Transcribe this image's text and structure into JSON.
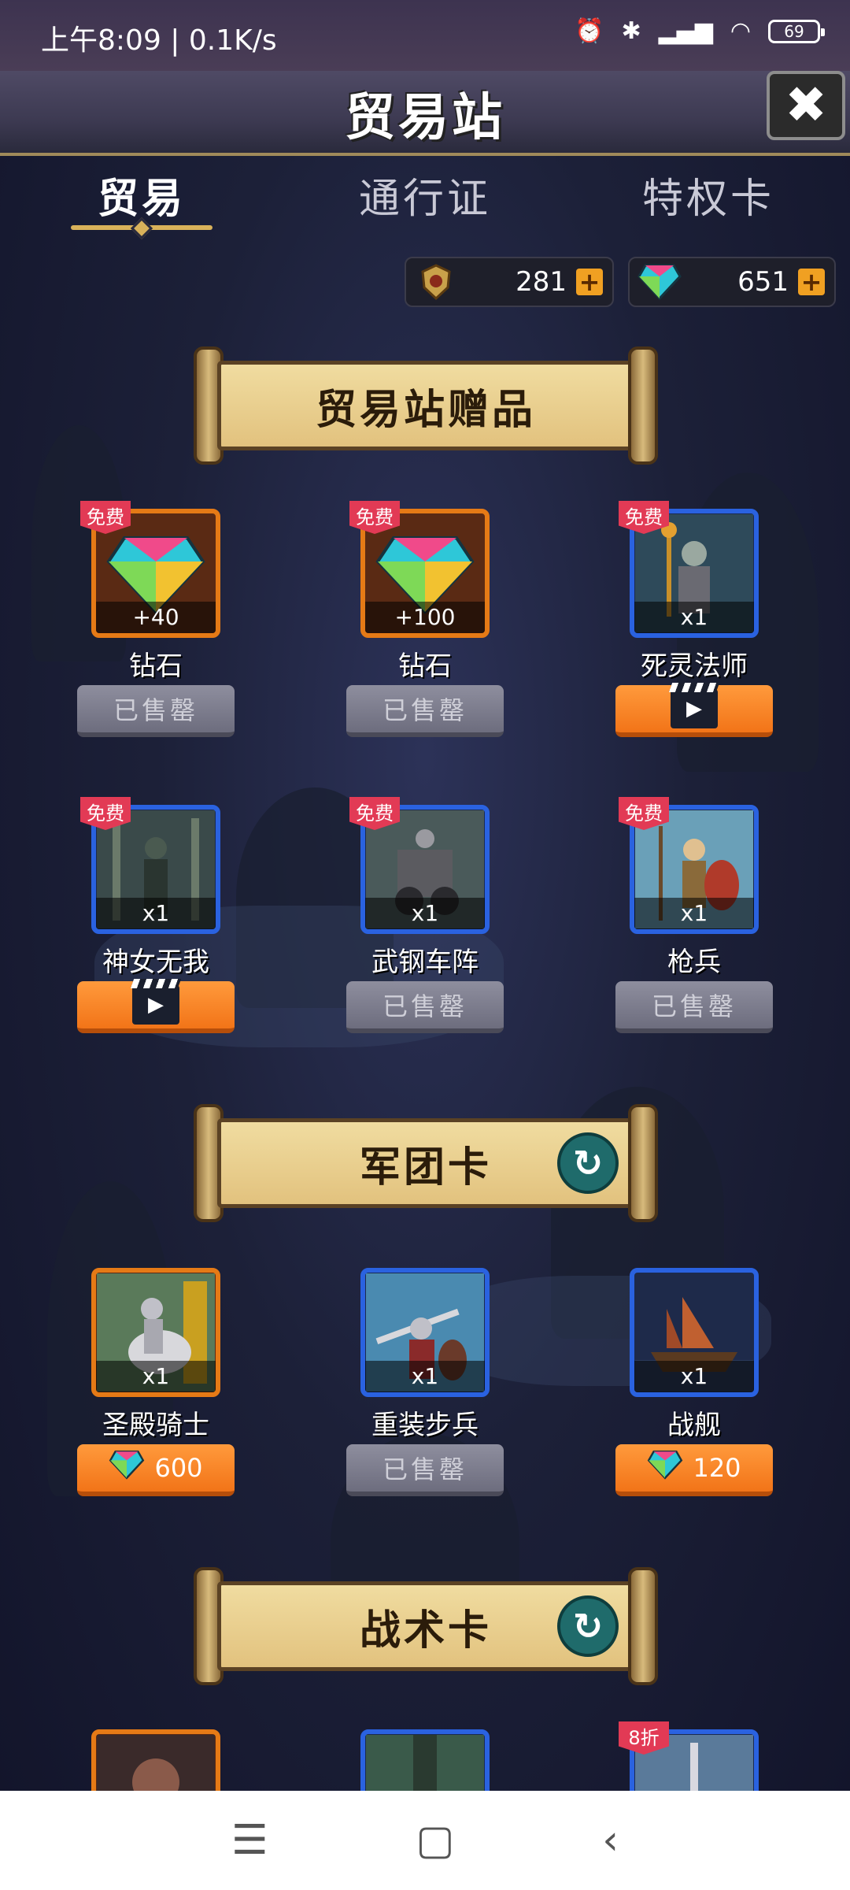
{
  "status_bar": {
    "time": "上午8:09 | 0.1K/s",
    "battery": "69"
  },
  "header": {
    "title": "贸易站"
  },
  "tabs": [
    {
      "label": "贸易",
      "active": true
    },
    {
      "label": "通行证",
      "active": false
    },
    {
      "label": "特权卡",
      "active": false
    }
  ],
  "currencies": [
    {
      "icon": "crest-icon",
      "value": "281"
    },
    {
      "icon": "diamond-icon",
      "value": "651"
    }
  ],
  "sections": {
    "gifts": {
      "title": "贸易站赠品",
      "items": [
        {
          "name": "钻石",
          "qty": "+40",
          "badge": "免费",
          "button": "已售罄",
          "button_type": "sold",
          "frame": "orange"
        },
        {
          "name": "钻石",
          "qty": "+100",
          "badge": "免费",
          "button": "已售罄",
          "button_type": "sold",
          "frame": "orange"
        },
        {
          "name": "死灵法师",
          "qty": "x1",
          "badge": "免费",
          "button_type": "video",
          "frame": "blue"
        },
        {
          "name": "神女无我",
          "qty": "x1",
          "badge": "免费",
          "button_type": "video",
          "frame": "blue"
        },
        {
          "name": "武钢车阵",
          "qty": "x1",
          "badge": "免费",
          "button": "已售罄",
          "button_type": "sold",
          "frame": "blue"
        },
        {
          "name": "枪兵",
          "qty": "x1",
          "badge": "免费",
          "button": "已售罄",
          "button_type": "sold",
          "frame": "blue"
        }
      ]
    },
    "legion": {
      "title": "军团卡",
      "items": [
        {
          "name": "圣殿骑士",
          "qty": "x1",
          "button": "600",
          "button_type": "price",
          "frame": "orange"
        },
        {
          "name": "重装步兵",
          "qty": "x1",
          "button": "已售罄",
          "button_type": "sold",
          "frame": "blue"
        },
        {
          "name": "战舰",
          "qty": "x1",
          "button": "120",
          "button_type": "price",
          "frame": "blue"
        }
      ]
    },
    "tactics": {
      "title": "战术卡",
      "items": [
        {
          "frame": "orange"
        },
        {
          "frame": "blue"
        },
        {
          "badge": "8折",
          "frame": "blue"
        }
      ]
    }
  },
  "colors": {
    "accent_orange": "#f27418",
    "frame_blue": "#2a62e0",
    "frame_orange": "#e57a16",
    "badge_red": "#e23a55",
    "gold": "#d9b25a"
  }
}
